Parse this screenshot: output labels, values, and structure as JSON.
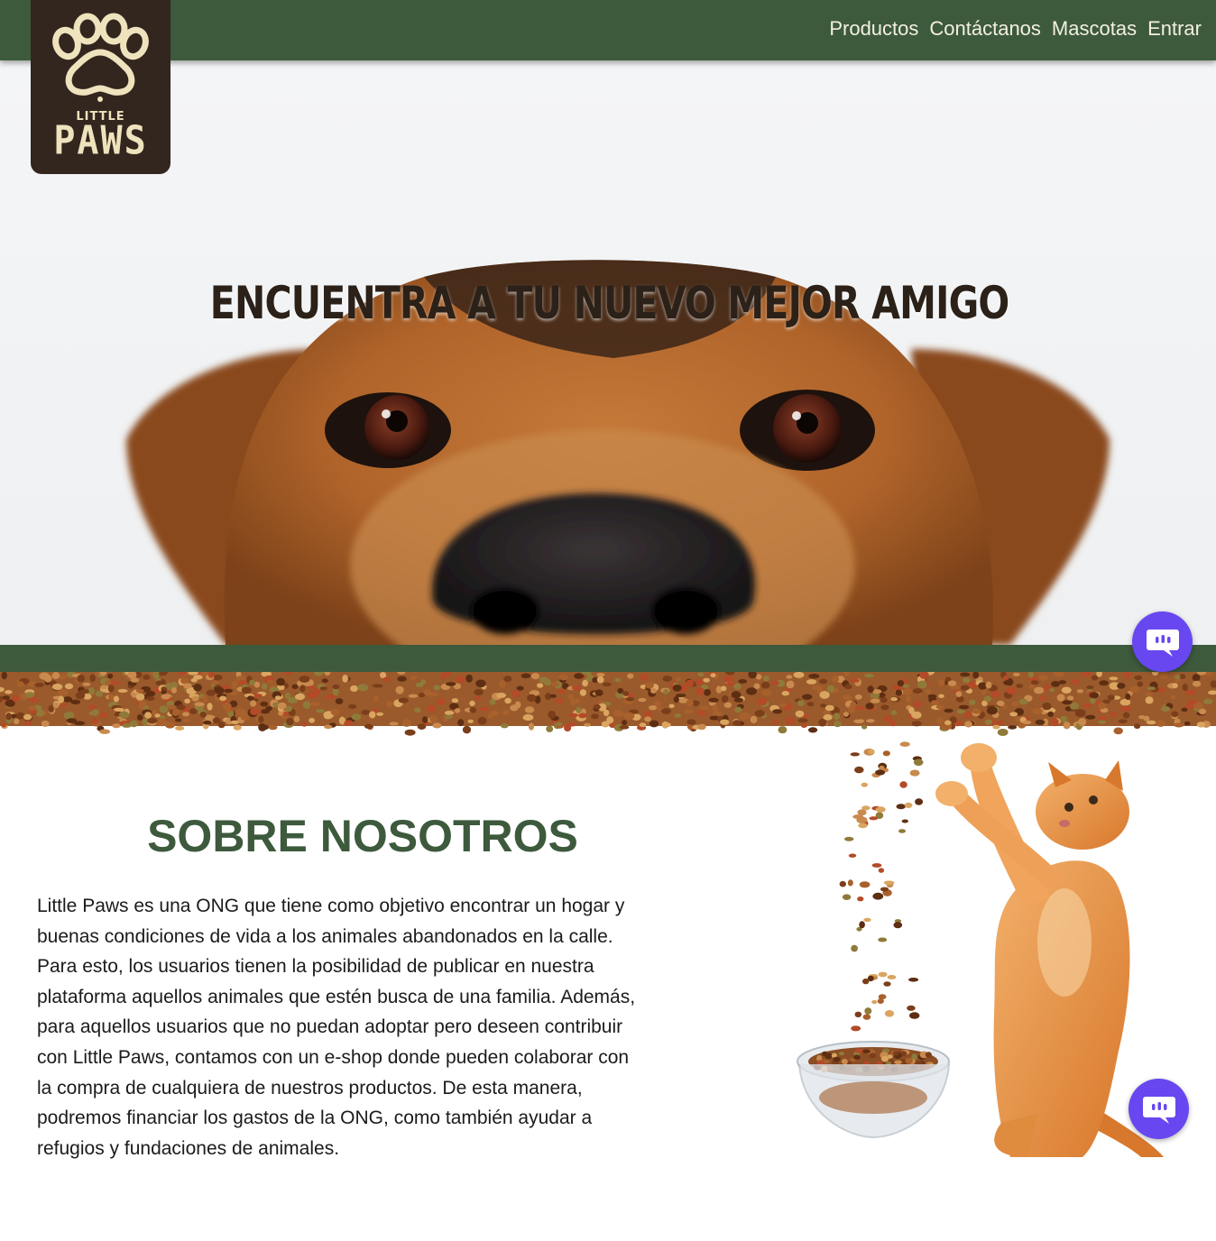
{
  "brand": {
    "small": "LITTLE",
    "big": "PAWS"
  },
  "nav": {
    "items": [
      "Productos",
      "Contáctanos",
      "Mascotas",
      "Entrar"
    ]
  },
  "hero": {
    "title": "ENCUENTRA A TU NUEVO MEJOR AMIGO"
  },
  "about": {
    "title": "SOBRE NOSOTROS",
    "lines": [
      "Little Paws es una ONG que tiene como objetivo encontrar un hogar y",
      "buenas condiciones de vida a los animales abandonados en la calle.",
      "Para esto, los usuarios tienen la posibilidad de publicar en nuestra",
      "plataforma aquellos animales que estén busca de una familia. Además,",
      "para aquellos usuarios que no puedan adoptar pero deseen contribuir",
      "con Little Paws, contamos con un e-shop donde pueden colaborar con",
      "la compra de cualquiera de nuestros productos. De esta manera,",
      "podremos financiar los gastos de la ONG, como también ayudar a",
      "refugios y fundaciones de animales."
    ]
  },
  "icons": {
    "logo": "paw-icon",
    "chat": "chat-icon"
  },
  "colors": {
    "nav_green": "#3d5a3c",
    "logo_brown": "#33261e",
    "chat_purple": "#6847f0"
  }
}
